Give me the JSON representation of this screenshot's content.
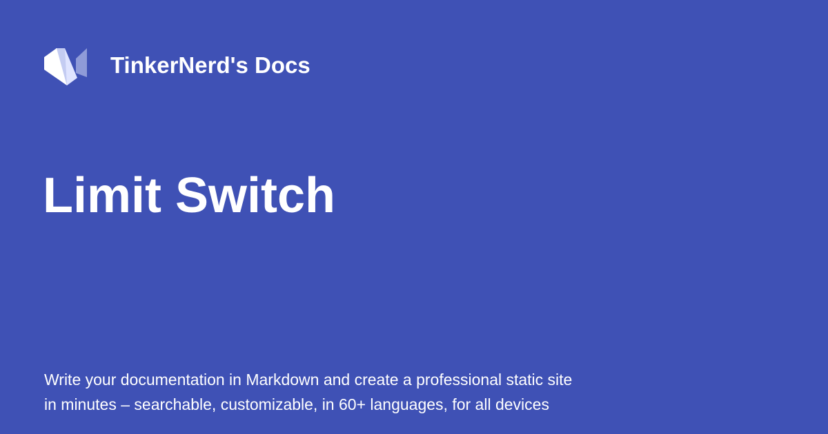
{
  "card": {
    "background_color": "#3f51b5",
    "text_color": "#ffffff",
    "logo_icon": "material-logo-icon",
    "site_name": "TinkerNerd's Docs",
    "title": "Limit Switch",
    "description": {
      "line1": "Write your documentation in Markdown and create a professional static site",
      "line2": "in minutes – searchable, customizable, in 60+ languages, for all devices"
    }
  }
}
